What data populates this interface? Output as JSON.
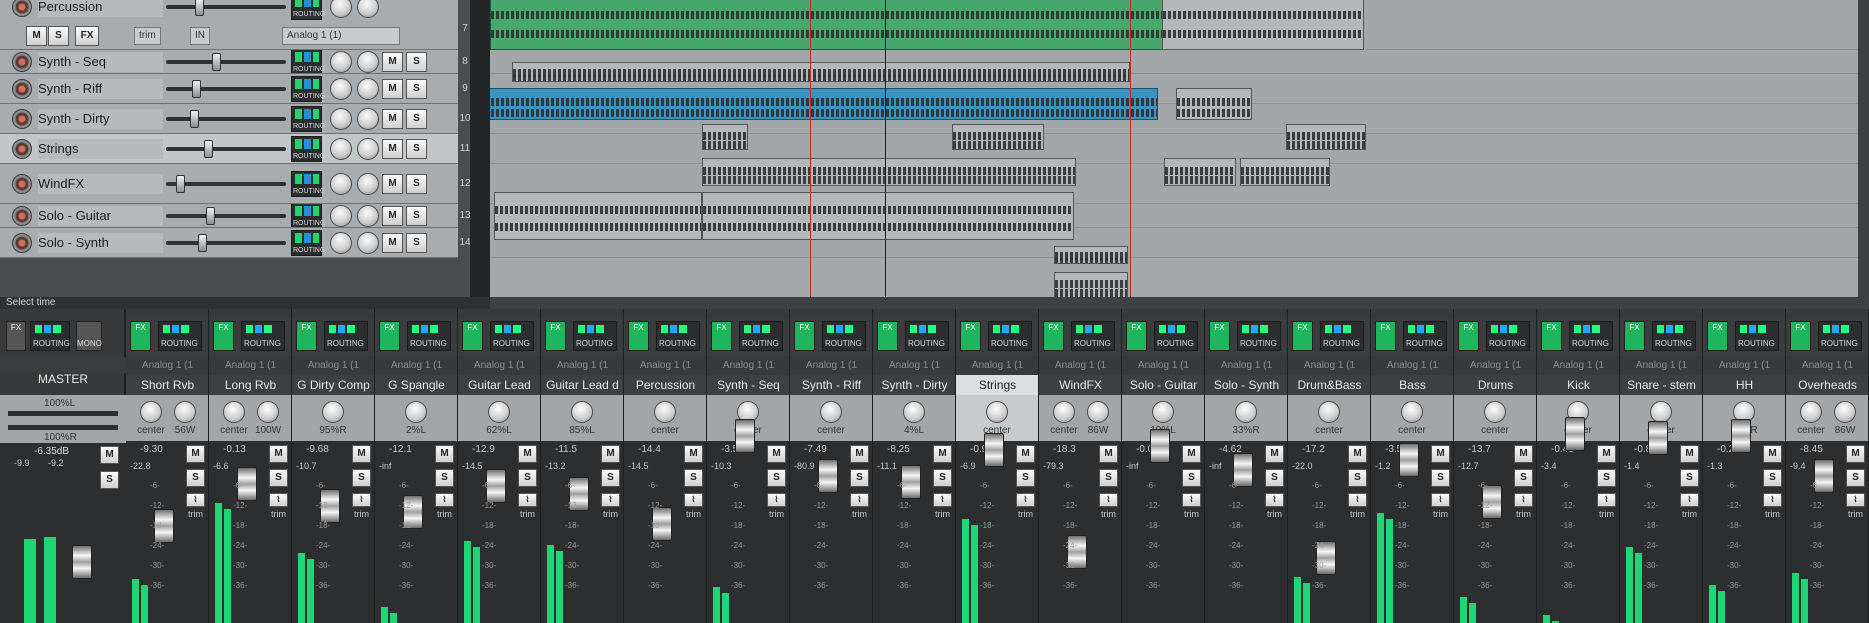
{
  "tracks": [
    {
      "name": "Percussion",
      "num": "7",
      "fx": "FX",
      "io_in": "IN",
      "io_input": "Analog 1 (1)",
      "trim": "trim",
      "m": "M",
      "s": "S",
      "routing": "ROUTING"
    },
    {
      "name": "Synth - Seq",
      "num": "8"
    },
    {
      "name": "Synth - Riff",
      "num": "9"
    },
    {
      "name": "Synth - Dirty",
      "num": "10"
    },
    {
      "name": "Strings",
      "num": "11"
    },
    {
      "name": "WindFX",
      "num": "12"
    },
    {
      "name": "Solo - Guitar",
      "num": "13"
    },
    {
      "name": "Solo - Synth",
      "num": "14"
    }
  ],
  "labels": {
    "m": "M",
    "s": "S",
    "routing": "ROUTING",
    "trim": "trim",
    "fx": "FX",
    "mono": "MONO"
  },
  "status": "Select time",
  "master": {
    "name": "MASTER",
    "vol": "-6.35dB",
    "peakL": "-9.9",
    "peakR": "-9.2",
    "panL": "100%L",
    "panR": "100%R"
  },
  "strips": [
    {
      "name": "Short Rvb",
      "input": "Analog 1 (1",
      "vol": "-9.30",
      "peak": "-22.8",
      "pan1": "center",
      "pan2": "56W"
    },
    {
      "name": "Long Rvb",
      "input": "Analog 1 (1",
      "vol": "-0.13",
      "peak": "-6.6",
      "pan1": "center",
      "pan2": "100W"
    },
    {
      "name": "G Dirty Comp",
      "input": "Analog 1 (1",
      "vol": "-9.68",
      "peak": "-10.7",
      "pan1": "95%R",
      "pan2": ""
    },
    {
      "name": "G Spangle",
      "input": "Analog 1 (1",
      "vol": "-12.1",
      "peak": "-inf",
      "pan1": "2%L",
      "pan2": ""
    },
    {
      "name": "Guitar Lead",
      "input": "Analog 1 (1",
      "vol": "-12.9",
      "peak": "-14.5",
      "pan1": "62%L",
      "pan2": ""
    },
    {
      "name": "Guitar Lead d",
      "input": "Analog 1 (1",
      "vol": "-11.5",
      "peak": "-13.2",
      "pan1": "85%L",
      "pan2": ""
    },
    {
      "name": "Percussion",
      "input": "Analog 1 (1",
      "vol": "-14.4",
      "peak": "-14.5",
      "pan1": "center",
      "pan2": ""
    },
    {
      "name": "Synth - Seq",
      "input": "Analog 1 (1",
      "vol": "-3.57",
      "peak": "-10.3",
      "pan1": "center",
      "pan2": ""
    },
    {
      "name": "Synth - Riff",
      "input": "Analog 1 (1",
      "vol": "-7.49",
      "peak": "-80.9",
      "pan1": "center",
      "pan2": ""
    },
    {
      "name": "Synth - Dirty",
      "input": "Analog 1 (1",
      "vol": "-8.25",
      "peak": "-11.1",
      "pan1": "4%L",
      "pan2": ""
    },
    {
      "name": "Strings",
      "input": "Analog 1 (1",
      "vol": "-0.93",
      "peak": "-6.9",
      "pan1": "center",
      "pan2": "",
      "sel": true
    },
    {
      "name": "WindFX",
      "input": "Analog 1 (1",
      "vol": "-18.3",
      "peak": "-79.3",
      "pan1": "center",
      "pan2": "86W"
    },
    {
      "name": "Solo - Guitar",
      "input": "Analog 1 (1",
      "vol": "-0.02",
      "peak": "-inf",
      "pan1": "19%L",
      "pan2": ""
    },
    {
      "name": "Solo - Synth",
      "input": "Analog 1 (1",
      "vol": "-4.62",
      "peak": "-inf",
      "pan1": "33%R",
      "pan2": ""
    },
    {
      "name": "Drum&Bass",
      "input": "Analog 1 (1",
      "vol": "-17.2",
      "peak": "-22.0",
      "pan1": "center",
      "pan2": ""
    },
    {
      "name": "Bass",
      "input": "Analog 1 (1",
      "vol": "-3.50",
      "peak": "-1.2",
      "pan1": "center",
      "pan2": ""
    },
    {
      "name": "Drums",
      "input": "Analog 1 (1",
      "vol": "-13.7",
      "peak": "-12.7",
      "pan1": "center",
      "pan2": ""
    },
    {
      "name": "Kick",
      "input": "Analog 1 (1",
      "vol": "-0.43",
      "peak": "-3.4",
      "pan1": "center",
      "pan2": ""
    },
    {
      "name": "Snare - stem",
      "input": "Analog 1 (1",
      "vol": "-0.86",
      "peak": "-1.4",
      "pan1": "center",
      "pan2": ""
    },
    {
      "name": "HH",
      "input": "Analog 1 (1",
      "vol": "-0.23",
      "peak": "-1.3",
      "pan1": "19%R",
      "pan2": ""
    },
    {
      "name": "Overheads",
      "input": "Analog 1 (1",
      "vol": "-8.45",
      "peak": "-9.4",
      "pan1": "center",
      "pan2": "86W"
    }
  ],
  "scale": [
    "-6-",
    "-12-",
    "-18-",
    "-24-",
    "-30-",
    "-36-"
  ]
}
